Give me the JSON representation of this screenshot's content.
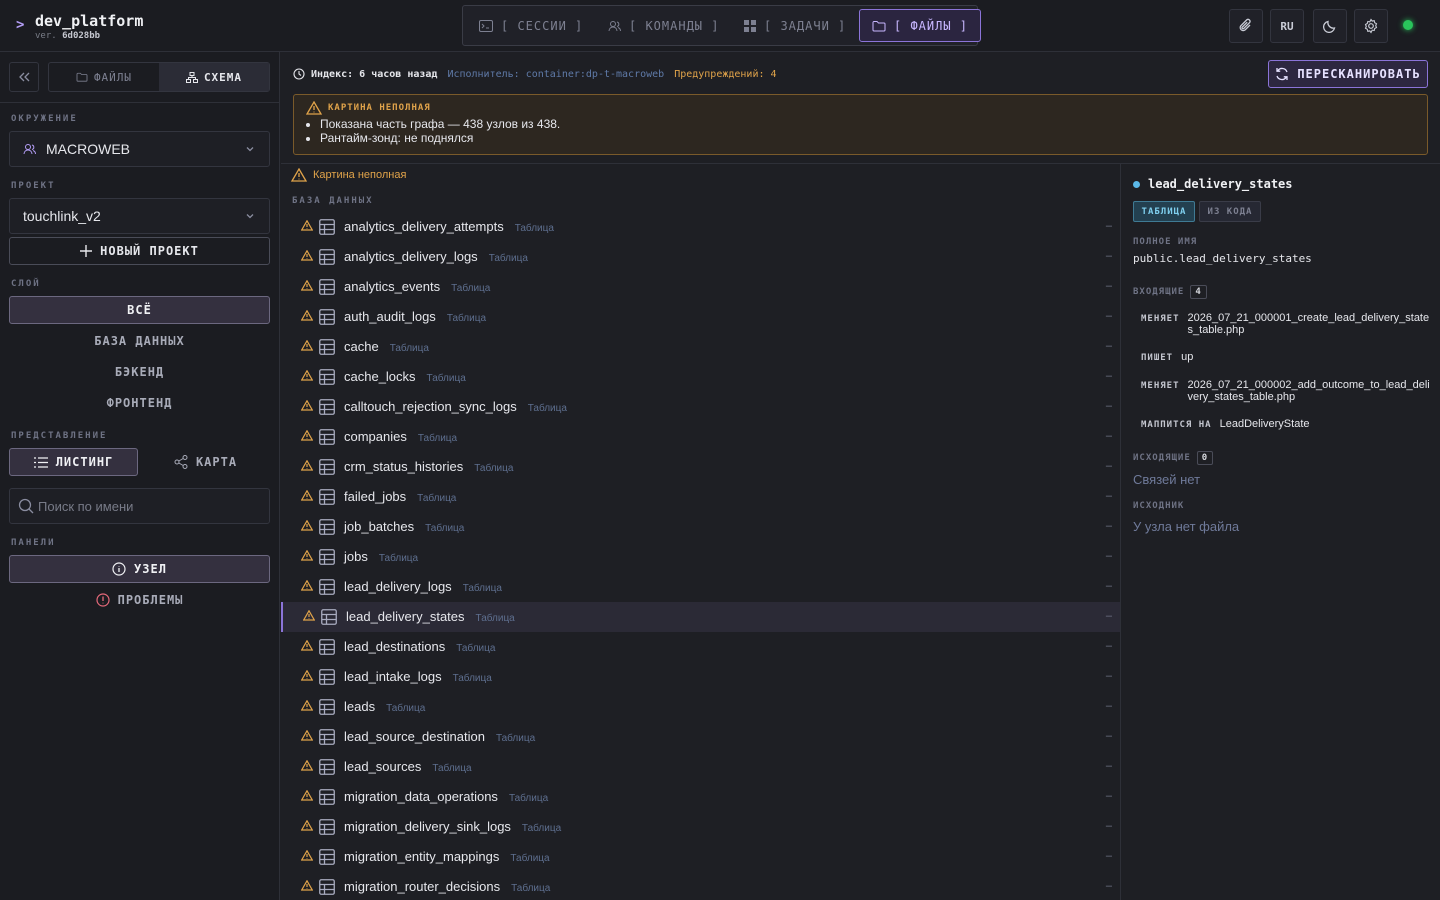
{
  "brand": {
    "prompt": ">",
    "name": "dev_platform",
    "ver_label": "ver.",
    "ver_hash": "6d028bb"
  },
  "nav": {
    "tabs": [
      {
        "label": "[ СЕССИИ ]",
        "icon": "terminal-icon"
      },
      {
        "label": "[ КОМАНДЫ ]",
        "icon": "users-icon"
      },
      {
        "label": "[ ЗАДАЧИ ]",
        "icon": "grid-icon"
      },
      {
        "label": "[ ФАЙЛЫ ]",
        "icon": "folder-icon",
        "active": true
      }
    ]
  },
  "toolbar": {
    "lang": "RU",
    "status_color": "#29c45b"
  },
  "sidebar": {
    "segtabs": [
      {
        "label": "ФАЙЛЫ"
      },
      {
        "label": "СХЕМА",
        "active": true
      }
    ],
    "env_label": "ОКРУЖЕНИЕ",
    "env_value": "MACROWEB",
    "project_label": "ПРОЕКТ",
    "project_value": "touchlink_v2",
    "new_project": "НОВЫЙ ПРОЕКТ",
    "layer_label": "СЛОЙ",
    "layers": [
      "ВСЁ",
      "БАЗА ДАННЫХ",
      "БЭКЕНД",
      "ФРОНТЕНД"
    ],
    "view_label": "ПРЕДСТАВЛЕНИЕ",
    "view_list": "ЛИСТИНГ",
    "view_map": "КАРТА",
    "search_placeholder": "Поиск по имени",
    "panels_label": "ПАНЕЛИ",
    "panel_node": "УЗЕЛ",
    "panel_problems": "ПРОБЛЕМЫ"
  },
  "header": {
    "index_text": "Индекс: 6 часов назад",
    "executor_text": "Исполнитель: container:dp-t-macroweb",
    "warnings_text": "Предупреждений: 4",
    "rescan": "ПЕРЕСКАНИРОВАТЬ",
    "banner_title": "КАРТИНА НЕПОЛНАЯ",
    "banner_items": [
      "Показана часть графа — 438 узлов из 438.",
      "Рантайм-зонд: не поднялся"
    ]
  },
  "list": {
    "warning": "Картина неполная",
    "section": "БАЗА ДАННЫХ",
    "kind": "Таблица",
    "dash": "–",
    "rows": [
      "analytics_delivery_attempts",
      "analytics_delivery_logs",
      "analytics_events",
      "auth_audit_logs",
      "cache",
      "cache_locks",
      "calltouch_rejection_sync_logs",
      "companies",
      "crm_status_histories",
      "failed_jobs",
      "job_batches",
      "jobs",
      "lead_delivery_logs",
      "lead_delivery_states",
      "lead_destinations",
      "lead_intake_logs",
      "leads",
      "lead_source_destination",
      "lead_sources",
      "migration_data_operations",
      "migration_delivery_sink_logs",
      "migration_entity_mappings",
      "migration_router_decisions"
    ],
    "selected": "lead_delivery_states"
  },
  "detail": {
    "title": "lead_delivery_states",
    "pill_primary": "ТАБЛИЦА",
    "pill_secondary": "ИЗ КОДА",
    "fullname_label": "ПОЛНОЕ ИМЯ",
    "fullname_value": "public.lead_delivery_states",
    "incoming_label": "ВХОДЯЩИЕ",
    "incoming_count": "4",
    "incoming": [
      {
        "verb": "МЕНЯЕТ",
        "obj": "2026_07_21_000001_create_lead_delivery_states_table.php"
      },
      {
        "verb": "ПИШЕТ",
        "obj": "up"
      },
      {
        "verb": "МЕНЯЕТ",
        "obj": "2026_07_21_000002_add_outcome_to_lead_delivery_states_table.php"
      },
      {
        "verb": "МАППИТСЯ НА",
        "obj": "LeadDeliveryState"
      }
    ],
    "outgoing_label": "ИСХОДЯЩИЕ",
    "outgoing_count": "0",
    "outgoing_empty": "Связей нет",
    "source_label": "ИСХОДНИК",
    "source_empty": "У узла нет файла"
  }
}
